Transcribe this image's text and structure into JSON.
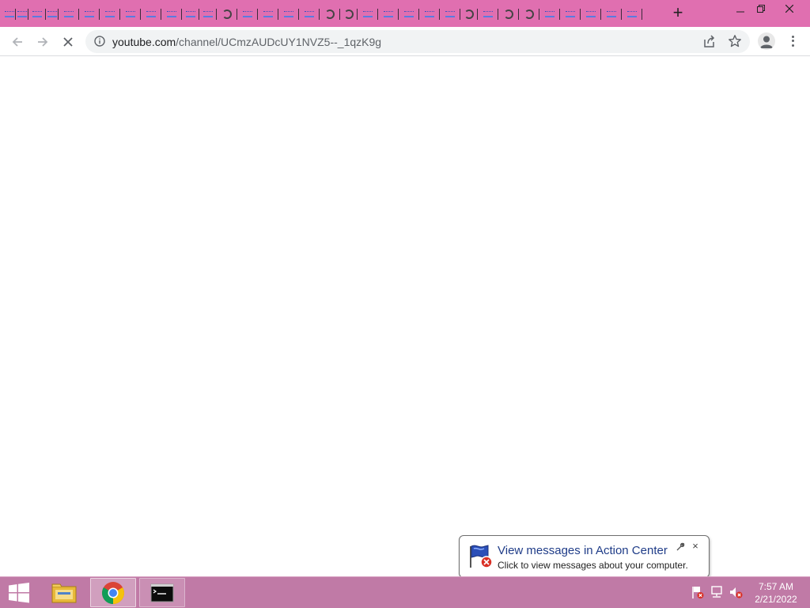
{
  "browser": {
    "url_host": "youtube.com",
    "url_path": "/channel/UCmzAUDcUY1NVZ5--_1qzK9g",
    "new_tab_label": "+",
    "tab_count": 33
  },
  "notification": {
    "title": "View messages in Action Center",
    "text": "Click to view messages about your computer.",
    "close_label": "×"
  },
  "taskbar": {
    "apps": [
      "windows-start",
      "file-explorer",
      "google-chrome",
      "command-prompt"
    ],
    "clock_time": "7:57 AM",
    "clock_date": "2/21/2022"
  },
  "colors": {
    "tabstrip": "#e06fb0",
    "taskbar": "#c07aa6",
    "link_blue": "#1f3c88"
  }
}
